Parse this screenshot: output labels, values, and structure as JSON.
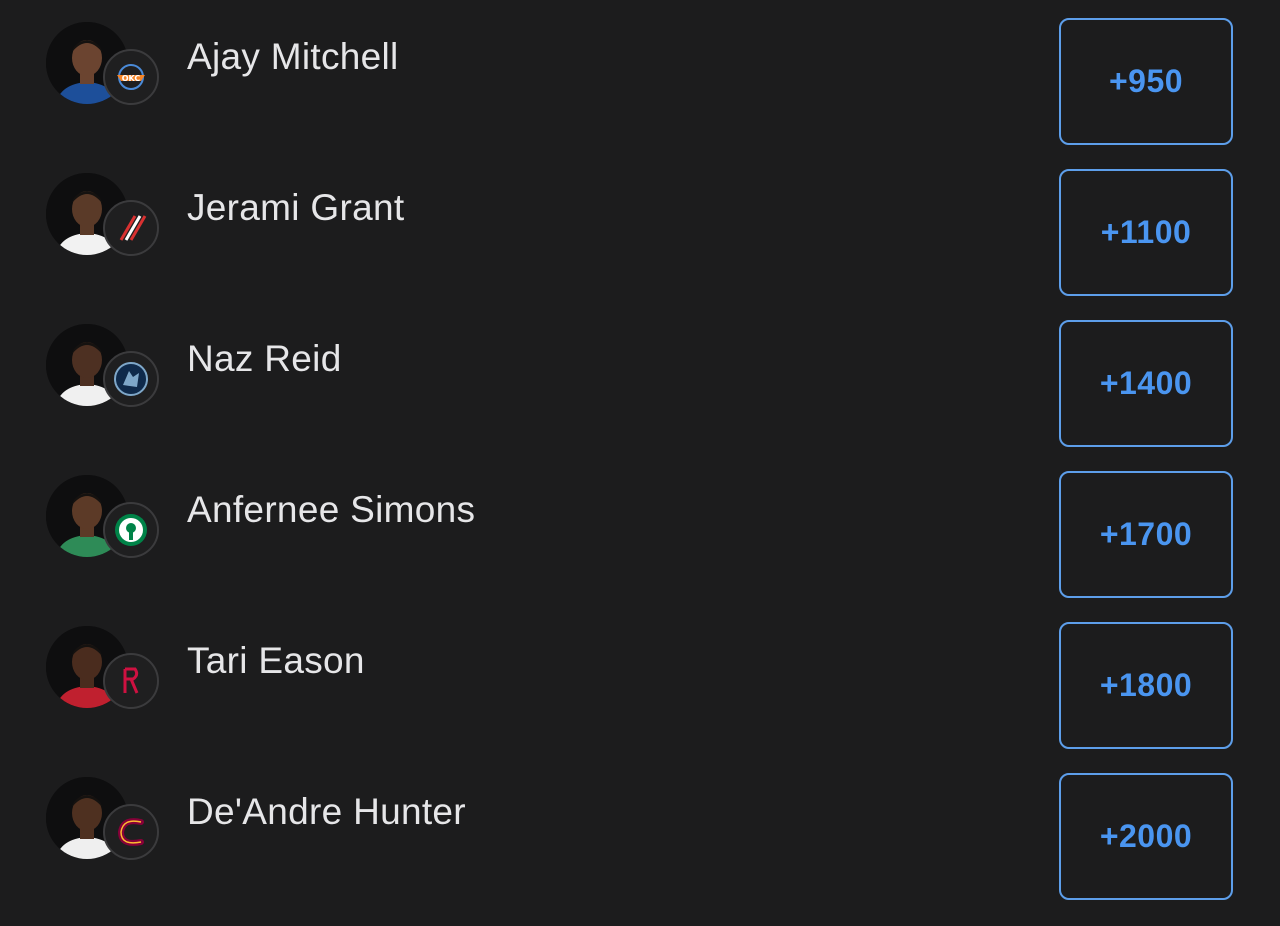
{
  "colors": {
    "background": "#1c1c1d",
    "accent": "#4a95f0",
    "button_border": "#5d9eea",
    "text": "#e6e6e8"
  },
  "players": [
    {
      "name": "Ajay Mitchell",
      "odds": "+950",
      "team_icon": "thunder-logo-icon",
      "jersey": "#1d4f9a",
      "skin": "#6b4430",
      "team_color": "#1a6fc2",
      "team_bg": "#1f3f70"
    },
    {
      "name": "Jerami Grant",
      "odds": "+1100",
      "team_icon": "trail-blazers-logo-icon",
      "jersey": "#f2f2f2",
      "skin": "#5a3a28",
      "team_color": "#d83131",
      "team_bg": "#1a1a1a"
    },
    {
      "name": "Naz Reid",
      "odds": "+1400",
      "team_icon": "timberwolves-logo-icon",
      "jersey": "#f0f0f0",
      "skin": "#4d3022",
      "team_color": "#7ea7c9",
      "team_bg": "#0f2a4b"
    },
    {
      "name": "Anfernee Simons",
      "odds": "+1700",
      "team_icon": "celtics-logo-icon",
      "jersey": "#2e8b57",
      "skin": "#5c3a27",
      "team_color": "#008348",
      "team_bg": "#f2f2f2"
    },
    {
      "name": "Tari Eason",
      "odds": "+1800",
      "team_icon": "rockets-logo-icon",
      "jersey": "#c0202f",
      "skin": "#4a2c1e",
      "team_color": "#ce1141",
      "team_bg": "#1a1a1a"
    },
    {
      "name": "De'Andre Hunter",
      "odds": "+2000",
      "team_icon": "cavaliers-logo-icon",
      "jersey": "#efefef",
      "skin": "#4e3020",
      "team_color": "#860038",
      "team_bg": "#1a1a1a"
    }
  ]
}
